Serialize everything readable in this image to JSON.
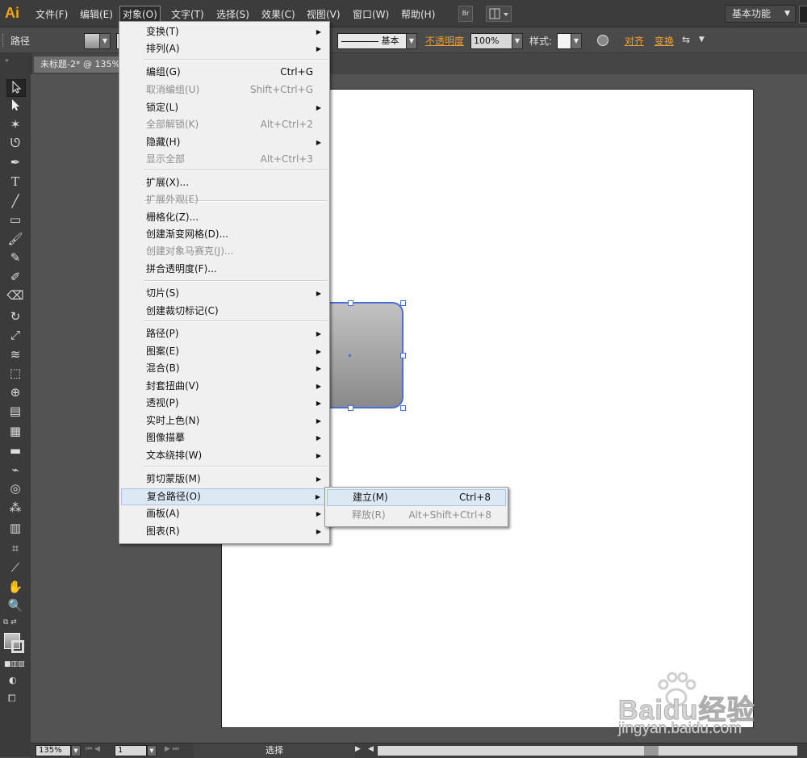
{
  "app": {
    "logo": "Ai"
  },
  "menubar": {
    "items": [
      "文件(F)",
      "编辑(E)",
      "对象(O)",
      "文字(T)",
      "选择(S)",
      "效果(C)",
      "视图(V)",
      "窗口(W)",
      "帮助(H)"
    ],
    "bridge_label": "Br",
    "workspace": "基本功能"
  },
  "controlbar": {
    "selection_label": "路径",
    "stroke_style": "基本",
    "opacity_label": "不透明度",
    "opacity_value": "100%",
    "style_label": "样式:",
    "align_label": "对齐",
    "transform_label": "变换"
  },
  "document": {
    "tab_title": "未标题-2* @ 135%"
  },
  "status": {
    "zoom": "135%",
    "artboard_no": "1",
    "tool_name": "选择"
  },
  "object_menu": {
    "items": [
      {
        "label": "变换(T)",
        "shortcut": "",
        "submenu": true,
        "disabled": false
      },
      {
        "label": "排列(A)",
        "shortcut": "",
        "submenu": true,
        "disabled": false
      },
      {
        "label": "编组(G)",
        "shortcut": "Ctrl+G",
        "submenu": false,
        "disabled": false
      },
      {
        "label": "取消编组(U)",
        "shortcut": "Shift+Ctrl+G",
        "submenu": false,
        "disabled": true
      },
      {
        "label": "锁定(L)",
        "shortcut": "",
        "submenu": true,
        "disabled": false
      },
      {
        "label": "全部解锁(K)",
        "shortcut": "Alt+Ctrl+2",
        "submenu": false,
        "disabled": true
      },
      {
        "label": "隐藏(H)",
        "shortcut": "",
        "submenu": true,
        "disabled": false
      },
      {
        "label": "显示全部",
        "shortcut": "Alt+Ctrl+3",
        "submenu": false,
        "disabled": true
      },
      {
        "label": "扩展(X)...",
        "shortcut": "",
        "submenu": false,
        "disabled": false
      },
      {
        "label": "扩展外观(E)",
        "shortcut": "",
        "submenu": false,
        "disabled": true
      },
      {
        "label": "栅格化(Z)...",
        "shortcut": "",
        "submenu": false,
        "disabled": false
      },
      {
        "label": "创建渐变网格(D)...",
        "shortcut": "",
        "submenu": false,
        "disabled": false
      },
      {
        "label": "创建对象马赛克(J)...",
        "shortcut": "",
        "submenu": false,
        "disabled": true
      },
      {
        "label": "拼合透明度(F)...",
        "shortcut": "",
        "submenu": false,
        "disabled": false
      },
      {
        "label": "切片(S)",
        "shortcut": "",
        "submenu": true,
        "disabled": false
      },
      {
        "label": "创建裁切标记(C)",
        "shortcut": "",
        "submenu": false,
        "disabled": false
      },
      {
        "label": "路径(P)",
        "shortcut": "",
        "submenu": true,
        "disabled": false
      },
      {
        "label": "图案(E)",
        "shortcut": "",
        "submenu": true,
        "disabled": false
      },
      {
        "label": "混合(B)",
        "shortcut": "",
        "submenu": true,
        "disabled": false
      },
      {
        "label": "封套扭曲(V)",
        "shortcut": "",
        "submenu": true,
        "disabled": false
      },
      {
        "label": "透视(P)",
        "shortcut": "",
        "submenu": true,
        "disabled": false
      },
      {
        "label": "实时上色(N)",
        "shortcut": "",
        "submenu": true,
        "disabled": false
      },
      {
        "label": "图像描摹",
        "shortcut": "",
        "submenu": true,
        "disabled": false
      },
      {
        "label": "文本绕排(W)",
        "shortcut": "",
        "submenu": true,
        "disabled": false
      },
      {
        "label": "剪切蒙版(M)",
        "shortcut": "",
        "submenu": true,
        "disabled": false
      },
      {
        "label": "复合路径(O)",
        "shortcut": "",
        "submenu": true,
        "disabled": false
      },
      {
        "label": "画板(A)",
        "shortcut": "",
        "submenu": true,
        "disabled": false
      },
      {
        "label": "图表(R)",
        "shortcut": "",
        "submenu": true,
        "disabled": false
      }
    ]
  },
  "compound_path_submenu": {
    "items": [
      {
        "label": "建立(M)",
        "shortcut": "Ctrl+8",
        "disabled": false
      },
      {
        "label": "释放(R)",
        "shortcut": "Alt+Shift+Ctrl+8",
        "disabled": true
      }
    ]
  },
  "watermark": {
    "brand": "Baidu经验",
    "url": "jingyan.baidu.com"
  },
  "colors": {
    "accent": "#f7a21b",
    "selection": "#4a6fd8",
    "menu_highlight": "#dde8f5"
  }
}
